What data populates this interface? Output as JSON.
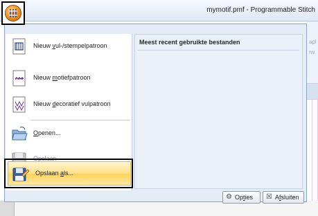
{
  "window": {
    "title": "mymotif.pmf - Programmable Stitch"
  },
  "app_button": {
    "icon": "stitch-app-icon"
  },
  "background": {
    "fragment_1": "apl",
    "fragment_2": "rw"
  },
  "menu": {
    "items": [
      {
        "pre": "Nieuw ",
        "key": "v",
        "post": "ul-/stempelpatroon",
        "icon": "fill-stamp-pattern-icon",
        "enabled": true
      },
      {
        "pre": "Nieuw ",
        "key": "m",
        "post": "otiefpatroon",
        "icon": "motif-pattern-icon",
        "enabled": true
      },
      {
        "pre": "Nieuw ",
        "key": "d",
        "post": "ecoratief vulpatroon",
        "icon": "decorative-fill-pattern-icon",
        "enabled": true
      },
      {
        "pre": "",
        "key": "O",
        "post": "penen...",
        "icon": "open-folder-icon",
        "enabled": true
      },
      {
        "pre": "O",
        "key": "p",
        "post": "slaan",
        "icon": "save-icon",
        "enabled": false
      },
      {
        "pre": "Opslaan ",
        "key": "a",
        "post": "ls...",
        "icon": "save-as-icon",
        "enabled": true,
        "highlighted": true
      }
    ],
    "recent": {
      "title": "Meest recent gebruikte bestanden",
      "files": []
    },
    "buttons": {
      "options": {
        "pre": "Op",
        "key": "t",
        "post": "ies",
        "icon": "options-gear-icon"
      },
      "close": {
        "pre": "A",
        "key": "f",
        "post": "sluiten",
        "icon": "close-x-icon"
      }
    }
  }
}
